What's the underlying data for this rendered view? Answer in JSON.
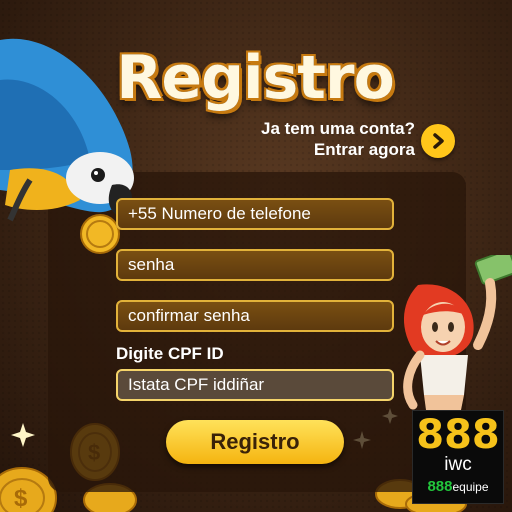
{
  "header": {
    "title": "Registro",
    "login_prompt_line1": "Ja tem uma conta?",
    "login_prompt_line2": "Entrar agora"
  },
  "form": {
    "phone_placeholder": "+55 Numero de telefone",
    "password_placeholder": "senha",
    "confirm_password_placeholder": "confirmar senha",
    "cpf_label": "Digite CPF ID",
    "cpf_placeholder": "Istata CPF iddiñar"
  },
  "actions": {
    "register_label": "Registro"
  },
  "brand": {
    "logo_number": "888",
    "logo_suffix": "iwc",
    "team_number": "888",
    "team_word": "equipe"
  },
  "icons": [
    "chevron-right-icon",
    "coin-icon",
    "parrot-illustration",
    "woman-illustration",
    "banknote-icon",
    "sparkle-icon"
  ],
  "colors": {
    "accent_gold": "#ffc61a",
    "field_border": "#e2b23a",
    "background": "#3b2414",
    "logo_green": "#22c63c"
  }
}
